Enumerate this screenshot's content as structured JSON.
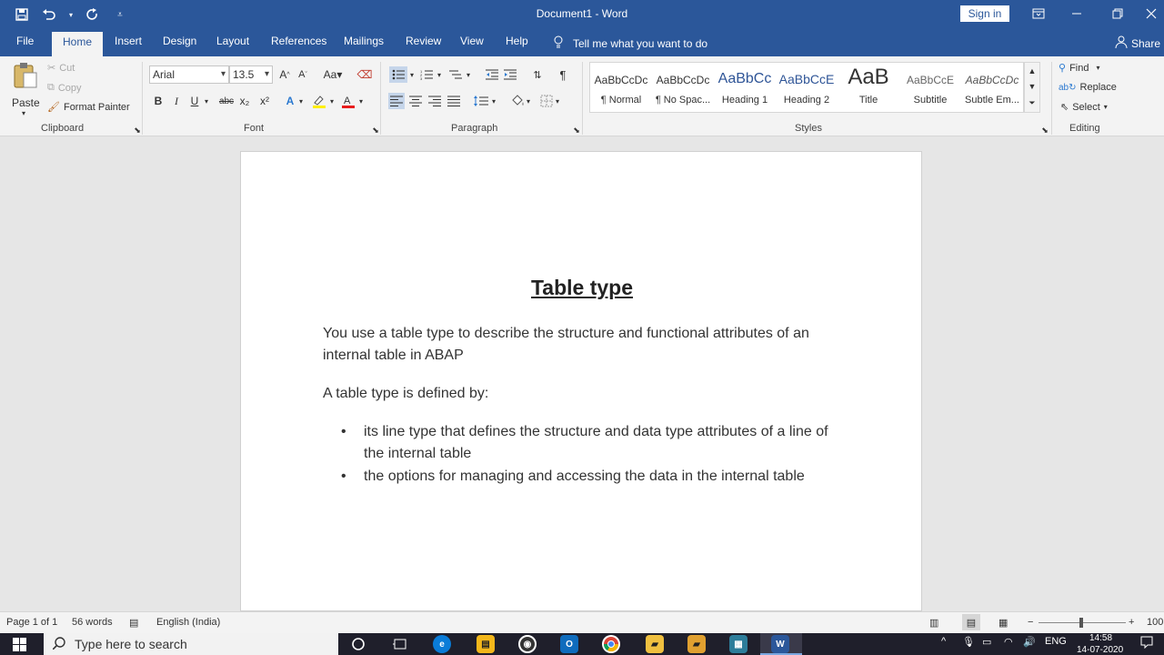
{
  "title_bar": {
    "document_title": "Document1 - Word",
    "sign_in_label": "Sign in"
  },
  "tabs": {
    "items": [
      "File",
      "Home",
      "Insert",
      "Design",
      "Layout",
      "References",
      "Mailings",
      "Review",
      "View",
      "Help"
    ],
    "active": "Home",
    "tell_me": "Tell me what you want to do",
    "share": "Share"
  },
  "clipboard": {
    "paste": "Paste",
    "cut": "Cut",
    "copy": "Copy",
    "format_painter": "Format Painter",
    "label": "Clipboard"
  },
  "font": {
    "family": "Arial",
    "size": "13.5",
    "change_case": "Aa",
    "bold": "B",
    "italic": "I",
    "underline": "U",
    "strikethrough": "abc",
    "subscript": "x₂",
    "superscript": "x²",
    "label": "Font"
  },
  "paragraph": {
    "label": "Paragraph"
  },
  "styles": {
    "items": [
      {
        "sample": "AaBbCcDc",
        "name": "¶ Normal"
      },
      {
        "sample": "AaBbCcDc",
        "name": "¶ No Spac..."
      },
      {
        "sample": "AaBbCc",
        "name": "Heading 1"
      },
      {
        "sample": "AaBbCcE",
        "name": "Heading 2"
      },
      {
        "sample": "AaB",
        "name": "Title"
      },
      {
        "sample": "AaBbCcE",
        "name": "Subtitle"
      },
      {
        "sample": "AaBbCcDc",
        "name": "Subtle Em..."
      }
    ],
    "label": "Styles"
  },
  "editing": {
    "find": "Find",
    "replace": "Replace",
    "select": "Select",
    "label": "Editing"
  },
  "document": {
    "heading": "Table type",
    "para1": "You use a table type to describe the structure and functional attributes of an internal table in ABAP",
    "para2": "A table type is defined by:",
    "bullets": [
      "its line type that defines the structure and data type attributes of a line of the internal table",
      "the options for managing and accessing the data in the internal table"
    ]
  },
  "status": {
    "page": "Page 1 of 1",
    "words": "56 words",
    "language": "English (India)",
    "zoom": "100"
  },
  "taskbar": {
    "search_placeholder": "Type here to search",
    "lang": "ENG",
    "time": "14:58",
    "date": "14-07-2020"
  },
  "colors": {
    "title_bar": "#2b579a",
    "ribbon": "#f3f3f3",
    "workspace": "#e6e6e6"
  }
}
